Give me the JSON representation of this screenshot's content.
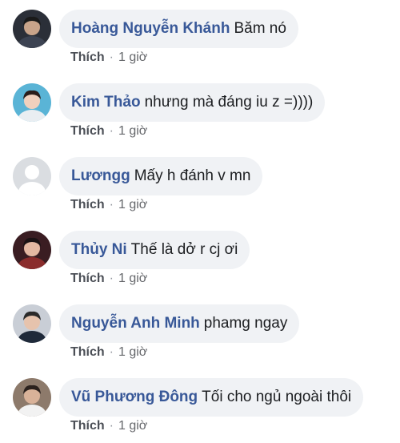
{
  "comments": [
    {
      "author": "Hoàng Nguyễn Khánh",
      "text": "Băm nó",
      "like_label": "Thích",
      "separator": "·",
      "time": "1 giờ",
      "avatar_icon": "user-avatar-photo",
      "avatar_colors": {
        "bg": "#2b2f38",
        "face": "#c9a48a",
        "hair": "#1a1a1a",
        "shirt": "#3c4352"
      }
    },
    {
      "author": "Kim Thảo",
      "text": "nhưng mà đáng iu z =))))",
      "like_label": "Thích",
      "separator": "·",
      "time": "1 giờ",
      "avatar_icon": "user-avatar-photo",
      "avatar_colors": {
        "bg": "#5ab4d6",
        "face": "#f0d0bd",
        "hair": "#2a1d1a",
        "shirt": "#e9eef2"
      }
    },
    {
      "author": "Lươngg",
      "text": "Mấy h đánh v mn",
      "like_label": "Thích",
      "separator": "·",
      "time": "1 giờ",
      "avatar_icon": "default-avatar-icon",
      "avatar_colors": {
        "bg": "#dadde1",
        "face": "#ffffff",
        "hair": "#ffffff",
        "shirt": "#ffffff"
      }
    },
    {
      "author": "Thủy Ni",
      "text": "Thế là dở r cj ơi",
      "like_label": "Thích",
      "separator": "·",
      "time": "1 giờ",
      "avatar_icon": "user-avatar-photo",
      "avatar_colors": {
        "bg": "#3a1d22",
        "face": "#e4b8a2",
        "hair": "#1b1214",
        "shirt": "#8a2c2c"
      }
    },
    {
      "author": "Nguyễn Anh Minh",
      "text": "phamg ngay",
      "like_label": "Thích",
      "separator": "·",
      "time": "1 giờ",
      "avatar_icon": "user-avatar-photo",
      "avatar_colors": {
        "bg": "#c9ced6",
        "face": "#e6c3ad",
        "hair": "#2a2a2a",
        "shirt": "#1f2a3a"
      }
    },
    {
      "author": "Vũ Phương Đông",
      "text": "Tối cho ngủ ngoài thôi",
      "like_label": "Thích",
      "separator": "·",
      "time": "1 giờ",
      "avatar_icon": "user-avatar-photo",
      "avatar_colors": {
        "bg": "#8d7a6b",
        "face": "#d9b299",
        "hair": "#2b211d",
        "shirt": "#f2f2f2"
      }
    }
  ]
}
